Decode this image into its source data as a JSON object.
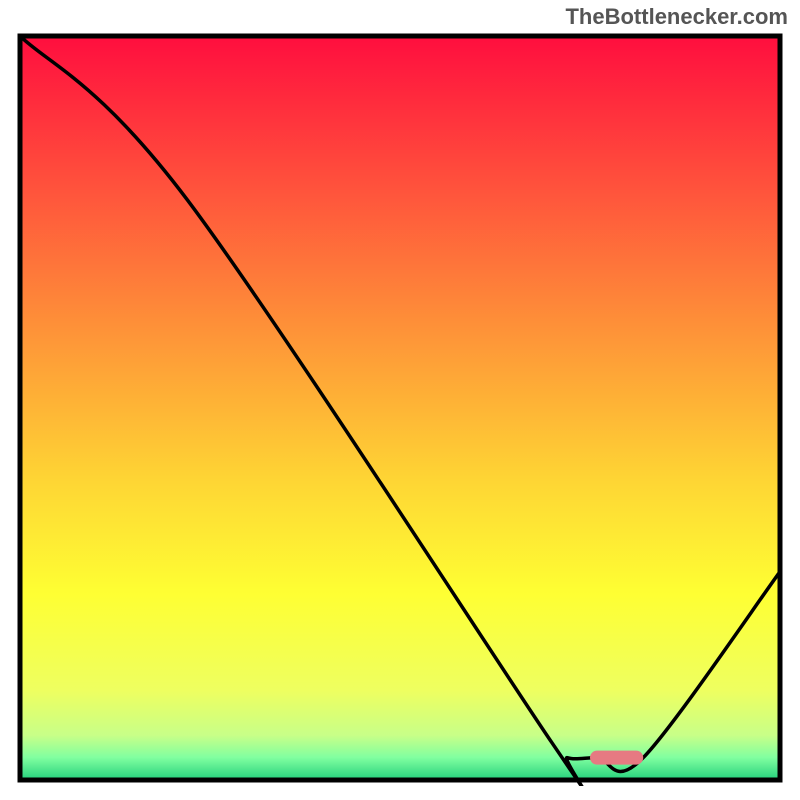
{
  "watermark": "TheBottlenecker.com",
  "chart_data": {
    "type": "line",
    "title": "",
    "xlabel": "",
    "ylabel": "",
    "xlim": [
      0,
      100
    ],
    "ylim": [
      0,
      100
    ],
    "background_gradient": {
      "stops": [
        {
          "offset": 0,
          "color": "#ff0e3e"
        },
        {
          "offset": 20,
          "color": "#ff513c"
        },
        {
          "offset": 40,
          "color": "#fe9438"
        },
        {
          "offset": 60,
          "color": "#fed634"
        },
        {
          "offset": 75,
          "color": "#feff33"
        },
        {
          "offset": 88,
          "color": "#eeff60"
        },
        {
          "offset": 94,
          "color": "#c8ff88"
        },
        {
          "offset": 97,
          "color": "#80ffa0"
        },
        {
          "offset": 100,
          "color": "#24d07c"
        }
      ]
    },
    "series": [
      {
        "name": "bottleneck-curve",
        "color": "#000000",
        "points": [
          {
            "x": 0,
            "y": 100
          },
          {
            "x": 22,
            "y": 78
          },
          {
            "x": 70,
            "y": 5
          },
          {
            "x": 72,
            "y": 3
          },
          {
            "x": 76,
            "y": 3
          },
          {
            "x": 82,
            "y": 3
          },
          {
            "x": 100,
            "y": 28
          }
        ]
      }
    ],
    "marker": {
      "name": "optimal-range",
      "x_start": 75,
      "x_end": 82,
      "y": 3,
      "color": "#e67a82"
    }
  }
}
